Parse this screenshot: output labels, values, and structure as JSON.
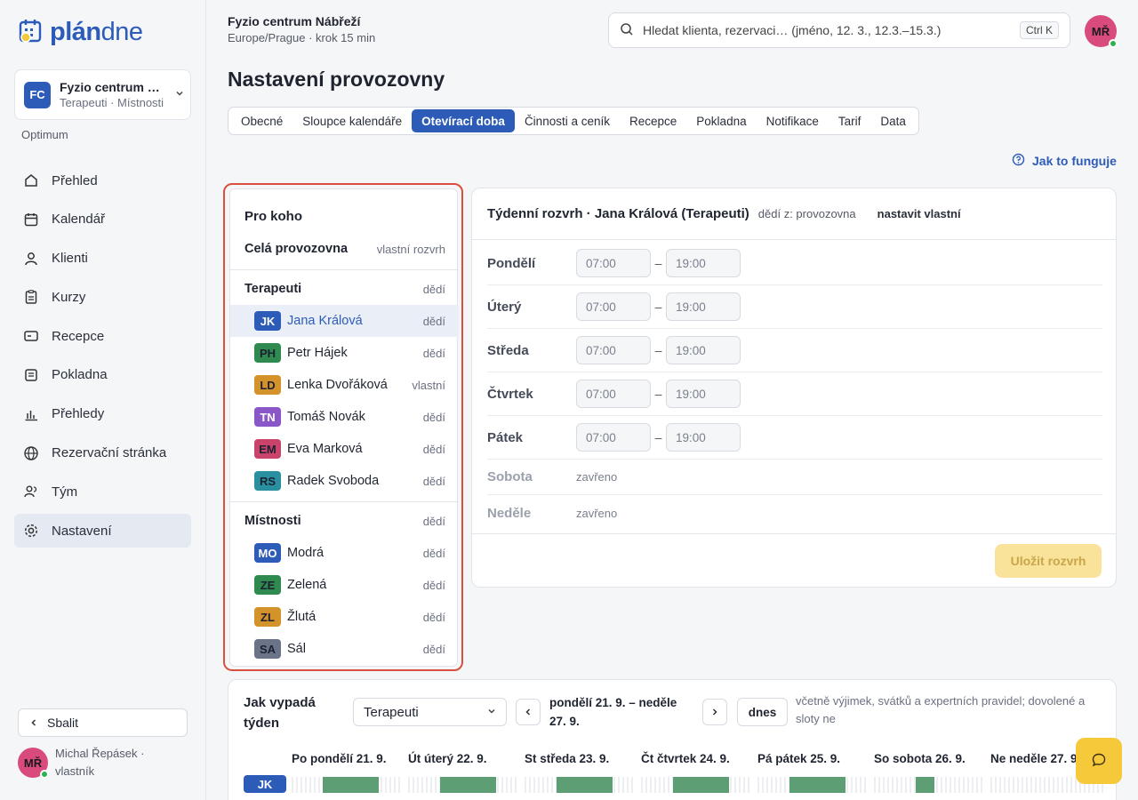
{
  "brand": {
    "logo_a": "plán",
    "logo_b": "dne"
  },
  "org": {
    "badge": "FC",
    "name": "Fyzio centrum Nábřeží",
    "sub": "Terapeuti · Místnosti",
    "plan": "Optimum"
  },
  "nav": [
    {
      "label": "Přehled",
      "icon": "home-icon"
    },
    {
      "label": "Kalendář",
      "icon": "calendar-icon"
    },
    {
      "label": "Klienti",
      "icon": "user-icon"
    },
    {
      "label": "Kurzy",
      "icon": "clipboard-icon"
    },
    {
      "label": "Recepce",
      "icon": "card-icon"
    },
    {
      "label": "Pokladna",
      "icon": "receipt-icon"
    },
    {
      "label": "Přehledy",
      "icon": "chart-icon"
    },
    {
      "label": "Rezervační stránka",
      "icon": "globe-icon"
    },
    {
      "label": "Tým",
      "icon": "team-icon"
    },
    {
      "label": "Nastavení",
      "icon": "gear-icon",
      "active": true
    }
  ],
  "collapse_label": "Sbalit",
  "user": {
    "initials": "MŘ",
    "line1": "Michal Řepásek ·",
    "line2": "vlastník"
  },
  "header": {
    "org_name": "Fyzio centrum Nábřeží",
    "org_sub": "Europe/Prague · krok 15 min",
    "search_placeholder": "Hledat klienta, rezervaci… (jméno, 12. 3., 12.3.–15.3.)",
    "search_kbd": "Ctrl K"
  },
  "page_title": "Nastavení provozovny",
  "tabs": [
    "Obecné",
    "Sloupce kalendáře",
    "Otevírací doba",
    "Činnosti a ceník",
    "Recepce",
    "Pokladna",
    "Notifikace",
    "Tarif",
    "Data"
  ],
  "active_tab": "Otevírací doba",
  "help_label": "Jak to funguje",
  "who": {
    "title": "Pro koho",
    "whole": {
      "label": "Celá provozovna",
      "status": "vlastní rozvrh"
    },
    "therapists": {
      "label": "Terapeuti",
      "status": "dědí",
      "items": [
        {
          "initials": "JK",
          "name": "Jana Králová",
          "status": "dědí",
          "color": "#2d5bb8",
          "selected": true
        },
        {
          "initials": "PH",
          "name": "Petr Hájek",
          "status": "dědí",
          "color": "#2e8a4f"
        },
        {
          "initials": "LD",
          "name": "Lenka Dvořáková",
          "status": "vlastní",
          "color": "#d4922a"
        },
        {
          "initials": "TN",
          "name": "Tomáš Novák",
          "status": "dědí",
          "color": "#8a57c9"
        },
        {
          "initials": "EM",
          "name": "Eva Marková",
          "status": "dědí",
          "color": "#c9436a"
        },
        {
          "initials": "RS",
          "name": "Radek Svoboda",
          "status": "dědí",
          "color": "#2a8f9e"
        }
      ]
    },
    "rooms": {
      "label": "Místnosti",
      "status": "dědí",
      "items": [
        {
          "initials": "MO",
          "name": "Modrá",
          "status": "dědí",
          "color": "#2d5bb8"
        },
        {
          "initials": "ZE",
          "name": "Zelená",
          "status": "dědí",
          "color": "#2e8a4f"
        },
        {
          "initials": "ZL",
          "name": "Žlutá",
          "status": "dědí",
          "color": "#d4922a"
        },
        {
          "initials": "SA",
          "name": "Sál",
          "status": "dědí",
          "color": "#6b7388"
        }
      ]
    }
  },
  "schedule": {
    "title": "Týdenní rozvrh · Jana Králová (Terapeuti)",
    "inherits": "dědí z: provozovna",
    "set_own": "nastavit vlastní",
    "days": [
      {
        "name": "Pondělí",
        "from": "07:00",
        "to": "19:00"
      },
      {
        "name": "Úterý",
        "from": "07:00",
        "to": "19:00"
      },
      {
        "name": "Středa",
        "from": "07:00",
        "to": "19:00"
      },
      {
        "name": "Čtvrtek",
        "from": "07:00",
        "to": "19:00"
      },
      {
        "name": "Pátek",
        "from": "07:00",
        "to": "19:00"
      },
      {
        "name": "Sobota",
        "closed": "zavřeno"
      },
      {
        "name": "Neděle",
        "closed": "zavřeno"
      }
    ],
    "save_label": "Uložit rozvrh"
  },
  "week": {
    "title": "Jak vypadá týden",
    "select": "Terapeuti",
    "range": "pondělí 21. 9. – neděle 27. 9.",
    "today": "dnes",
    "note": "včetně výjimek, svátků a expertních pravidel; dovolené a sloty ne",
    "days": [
      "Po pondělí 21. 9.",
      "Út úterý 22. 9.",
      "St středa 23. 9.",
      "Čt čtvrtek 24. 9.",
      "Pá pátek 25. 9.",
      "So sobota 26. 9.",
      "Ne neděle 27. 9."
    ],
    "row_label": "JK"
  },
  "colors": {
    "accent": "#2d5bb8",
    "highlight": "#dc4e3e",
    "save": "#f9e29a",
    "busy": "#5d9e74"
  }
}
